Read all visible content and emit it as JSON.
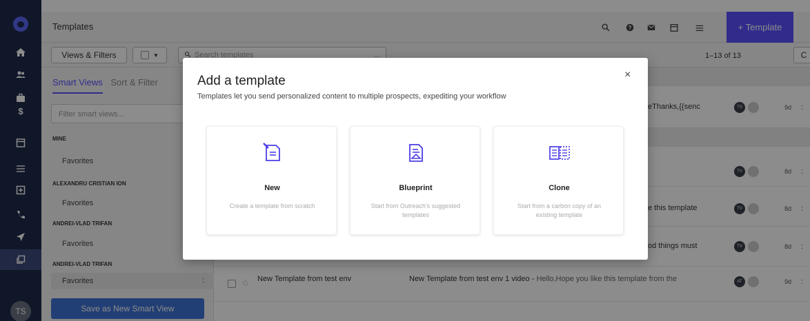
{
  "topbar": {
    "title": "Templates",
    "add_button": "+ Template",
    "icons": [
      "search-icon",
      "help-icon",
      "mail-icon",
      "calendar-icon",
      "tasks-icon"
    ]
  },
  "toolbar": {
    "views_button": "Views & Filters",
    "search_placeholder": "Search templates",
    "search_hint": "...",
    "pager": "1–13 of 13",
    "refresh": "C"
  },
  "sidebar": {
    "tab_smart": "Smart Views",
    "tab_sort": "Sort & Filter",
    "filter_placeholder": "Filter smart views...",
    "groups": [
      {
        "name": "MINE",
        "item": "Favorites"
      },
      {
        "name": "ALEXANDRU CRISTIAN ION",
        "item": "Favorites"
      },
      {
        "name": "ANDREI-VLAD TRIFAN",
        "item": "Favorites"
      },
      {
        "name": "ANDREI-VLAD TRIFAN",
        "item": "Favorites"
      }
    ],
    "save_button": "Save as New Smart View",
    "dots": ":"
  },
  "rail": {
    "icons": [
      "home-icon",
      "people-icon",
      "briefcase-icon",
      "dollar-icon",
      "calendar-icon",
      "tasks-icon",
      "report-icon",
      "phone-icon",
      "send-icon",
      "templates-icon"
    ],
    "avatar": "TS"
  },
  "list": {
    "row_snippets": [
      "eThanks,{{senc",
      "e this template",
      "od things must"
    ],
    "avatars": [
      "TS",
      "TV",
      "TV",
      "TV",
      "AT"
    ],
    "ages": [
      "9d",
      "8d",
      "8d",
      "8d",
      "9d"
    ],
    "kebab": ":",
    "visible_row": {
      "name": "New Template from test env",
      "subject": "New Template from test env 1 video - ",
      "body": "Hello,Hope you like this template from the"
    }
  },
  "modal": {
    "title": "Add a template",
    "subtitle": "Templates let you send personalized content to multiple prospects, expediting your workflow",
    "close": "×",
    "cards": [
      {
        "icon": "new-document-icon",
        "title": "New",
        "desc": "Create a template from scratch"
      },
      {
        "icon": "blueprint-icon",
        "title": "Blueprint",
        "desc": "Start from Outreach's suggested templates"
      },
      {
        "icon": "clone-icon",
        "title": "Clone",
        "desc": "Start from a carbon copy of an existing template"
      }
    ]
  },
  "colors": {
    "rail": "#1e2a4a",
    "accent": "#5951ff",
    "save_button": "#3e74d6"
  }
}
